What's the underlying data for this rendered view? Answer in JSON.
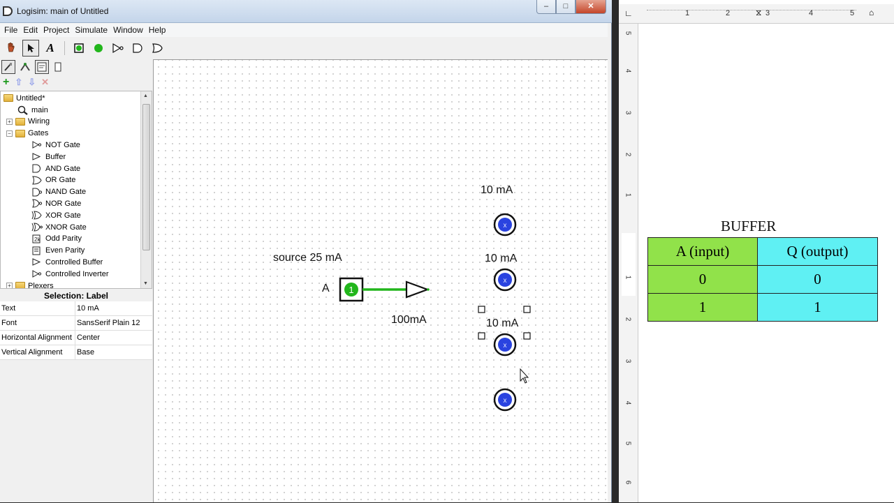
{
  "window": {
    "title": "Logisim: main of Untitled"
  },
  "window_buttons": {
    "minimize": "–",
    "maximize": "□",
    "close": "✕"
  },
  "menu": [
    "File",
    "Edit",
    "Project",
    "Simulate",
    "Window",
    "Help"
  ],
  "explorer": {
    "root": "Untitled*",
    "items": [
      {
        "label": "main",
        "indent": 1,
        "type": "circuit"
      },
      {
        "label": "Wiring",
        "indent": 1,
        "type": "folder",
        "expander": "+"
      },
      {
        "label": "Gates",
        "indent": 1,
        "type": "folder",
        "expander": "−"
      },
      {
        "label": "NOT Gate",
        "indent": 2,
        "type": "gate"
      },
      {
        "label": "Buffer",
        "indent": 2,
        "type": "gate"
      },
      {
        "label": "AND Gate",
        "indent": 2,
        "type": "gate"
      },
      {
        "label": "OR Gate",
        "indent": 2,
        "type": "gate"
      },
      {
        "label": "NAND Gate",
        "indent": 2,
        "type": "gate"
      },
      {
        "label": "NOR Gate",
        "indent": 2,
        "type": "gate"
      },
      {
        "label": "XOR Gate",
        "indent": 2,
        "type": "gate"
      },
      {
        "label": "XNOR Gate",
        "indent": 2,
        "type": "gate"
      },
      {
        "label": "Odd Parity",
        "indent": 2,
        "type": "gate"
      },
      {
        "label": "Even Parity",
        "indent": 2,
        "type": "gate"
      },
      {
        "label": "Controlled Buffer",
        "indent": 2,
        "type": "gate"
      },
      {
        "label": "Controlled Inverter",
        "indent": 2,
        "type": "gate"
      },
      {
        "label": "Plexers",
        "indent": 1,
        "type": "folder",
        "expander": "+"
      }
    ]
  },
  "attributes": {
    "title": "Selection: Label",
    "rows": [
      {
        "key": "Text",
        "value": "10 mA"
      },
      {
        "key": "Font",
        "value": "SansSerif Plain 12"
      },
      {
        "key": "Horizontal Alignment",
        "value": "Center"
      },
      {
        "key": "Vertical Alignment",
        "value": "Base"
      }
    ]
  },
  "canvas": {
    "labels": {
      "source": "source 25 mA",
      "input_name": "A",
      "buffer_current": "100mA",
      "led1": "10 mA",
      "led2": "10 mA",
      "led3": "10 mA"
    },
    "input_value": "1",
    "led_value": "x"
  },
  "document": {
    "ruler_top": [
      "1",
      "2",
      "3",
      "4",
      "5"
    ],
    "ruler_left": [
      "5",
      "4",
      "3",
      "2",
      "1",
      "1",
      "2",
      "3",
      "4",
      "5",
      "6"
    ],
    "table_title": "BUFFER",
    "table": {
      "headers": [
        "A (input)",
        "Q (output)"
      ],
      "rows": [
        [
          "0",
          "0"
        ],
        [
          "1",
          "1"
        ]
      ]
    },
    "colors": {
      "input_col": "#91e24a",
      "output_col": "#5ff0f3"
    }
  },
  "colors": {
    "wire_active": "#22b61c",
    "led_blue": "#2a43e0"
  }
}
